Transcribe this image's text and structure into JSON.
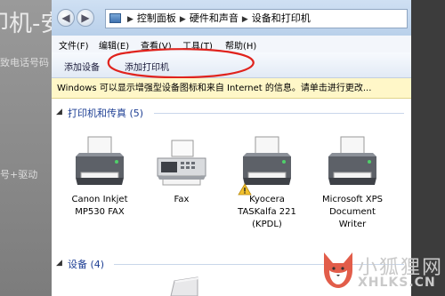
{
  "background": {
    "title_fragment": "印机-安",
    "side_text_1": "致电话号码",
    "side_text_2": "号+驱动"
  },
  "address_bar": {
    "path": [
      "控制面板",
      "硬件和声音",
      "设备和打印机"
    ]
  },
  "menu": {
    "items": [
      "文件(F)",
      "编辑(E)",
      "查看(V)",
      "工具(T)",
      "帮助(H)"
    ]
  },
  "toolbar": {
    "add_device": "添加设备",
    "add_printer": "添加打印机"
  },
  "infobar": {
    "text": "Windows 可以显示增强型设备图标和来自 Internet 的信息。请单击进行更改..."
  },
  "sections": {
    "printers_header": "打印机和传真 (5)",
    "devices_header": "设备 (4)"
  },
  "printers": [
    {
      "label_line1": "Canon Inkjet",
      "label_line2": "MP530 FAX",
      "label_line3": "",
      "icon": "printer-icon"
    },
    {
      "label_line1": "Fax",
      "label_line2": "",
      "label_line3": "",
      "icon": "fax-icon"
    },
    {
      "label_line1": "Kyocera",
      "label_line2": "TASKalfa 221",
      "label_line3": "(KPDL)",
      "icon": "printer-icon"
    },
    {
      "label_line1": "Microsoft XPS",
      "label_line2": "Document",
      "label_line3": "Writer",
      "icon": "printer-icon"
    }
  ],
  "watermark": {
    "line1": "小狐狸网",
    "line2": "XHLKS.CN"
  },
  "colors": {
    "section_header": "#1e3f94",
    "annotation": "#e0231d",
    "infobar": "#fff7c8"
  }
}
